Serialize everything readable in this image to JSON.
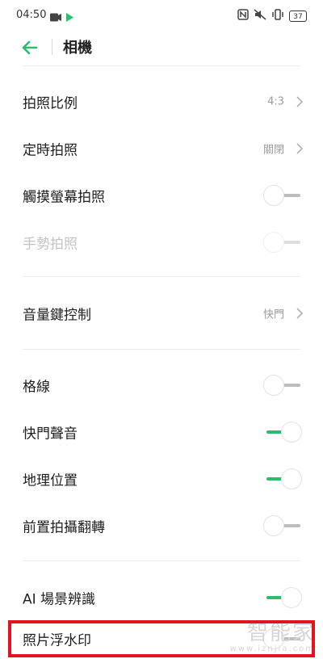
{
  "status_bar": {
    "time": "04:50",
    "battery": "37",
    "icons_left": [
      "video-icon",
      "play-icon"
    ],
    "icons_right": [
      "nfc-icon",
      "mute-icon",
      "vibrate-icon",
      "battery-icon"
    ]
  },
  "header": {
    "title": "相機",
    "back_icon": "back-arrow-icon",
    "accent_color": "#2dbb6e"
  },
  "settings": [
    {
      "label": "拍照比例",
      "value": "4:3"
    },
    {
      "label": "定時拍照",
      "value": "關閉"
    },
    {
      "label": "觸摸螢幕拍照",
      "toggle": "off"
    },
    {
      "label": "手勢拍照",
      "toggle": "off",
      "disabled": true
    },
    {
      "label": "音量鍵控制",
      "value": "快門"
    },
    {
      "label": "格線",
      "toggle": "off"
    },
    {
      "label": "快門聲音",
      "toggle": "on"
    },
    {
      "label": "地理位置",
      "toggle": "on"
    },
    {
      "label": "前置拍攝翻轉",
      "toggle": "off"
    },
    {
      "label": "AI 場景辨識",
      "toggle": "on"
    },
    {
      "label": "照片浮水印",
      "toggle": "off"
    }
  ],
  "watermark": {
    "text": "智能家",
    "url": "www.iznjia.com"
  },
  "highlight_color": "#e5121f"
}
